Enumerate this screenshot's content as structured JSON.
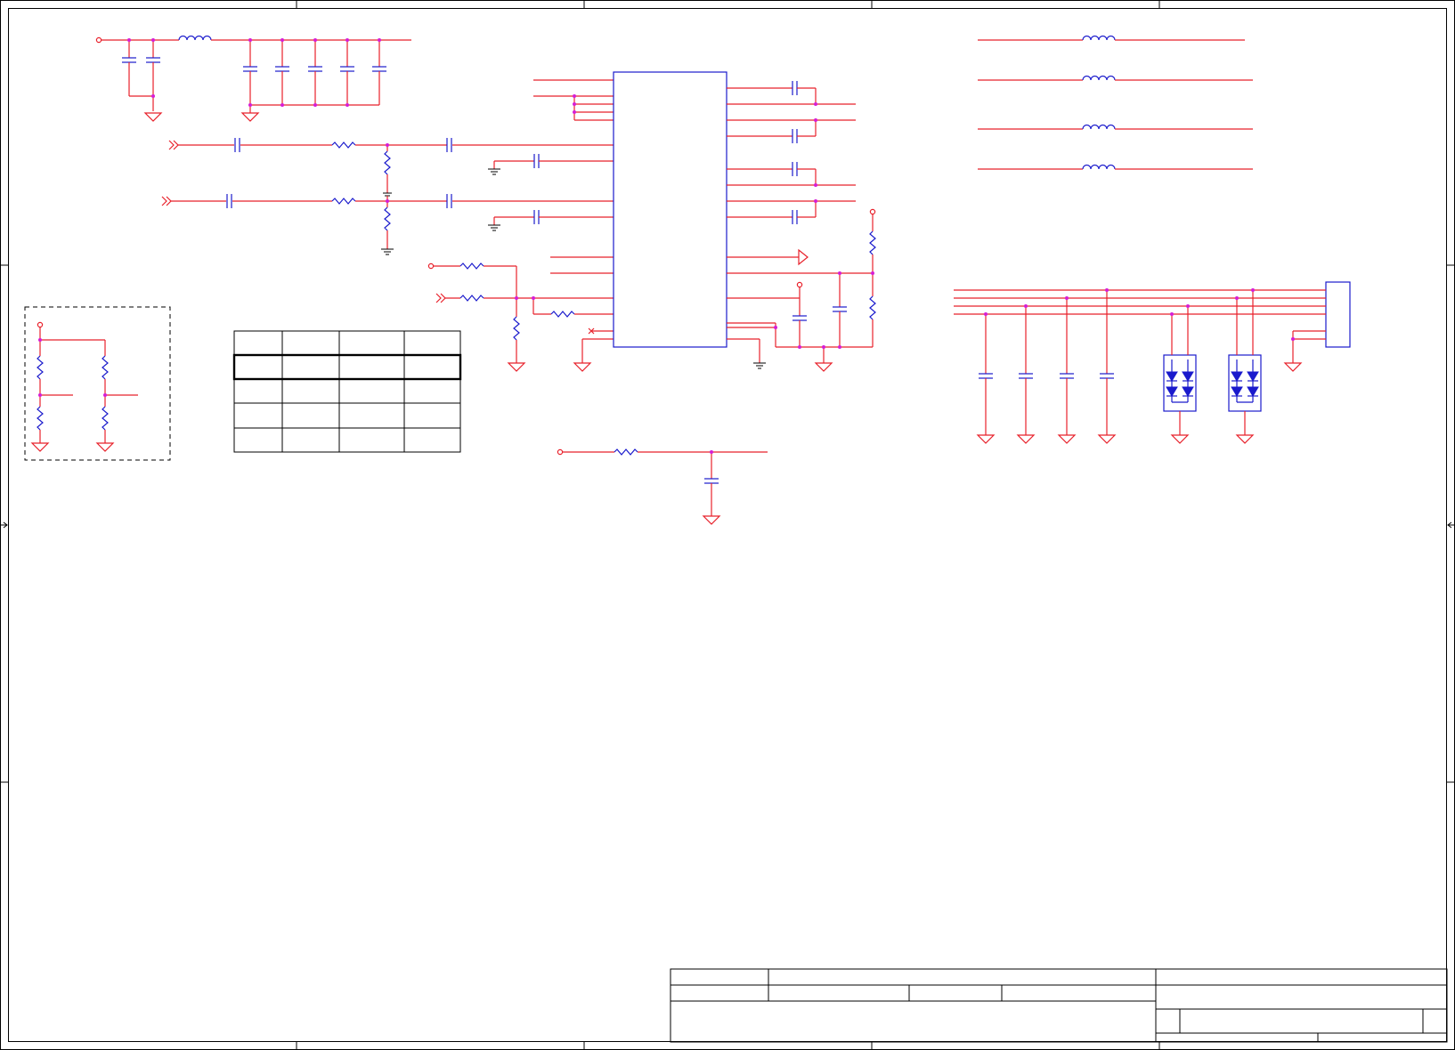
{
  "sheet": {
    "background": "#ffffff",
    "wire_color": "#e8202a",
    "component_color": "#1a1acc",
    "junction_color": "#d61ed6",
    "border_color": "#000000"
  },
  "labels": []
}
